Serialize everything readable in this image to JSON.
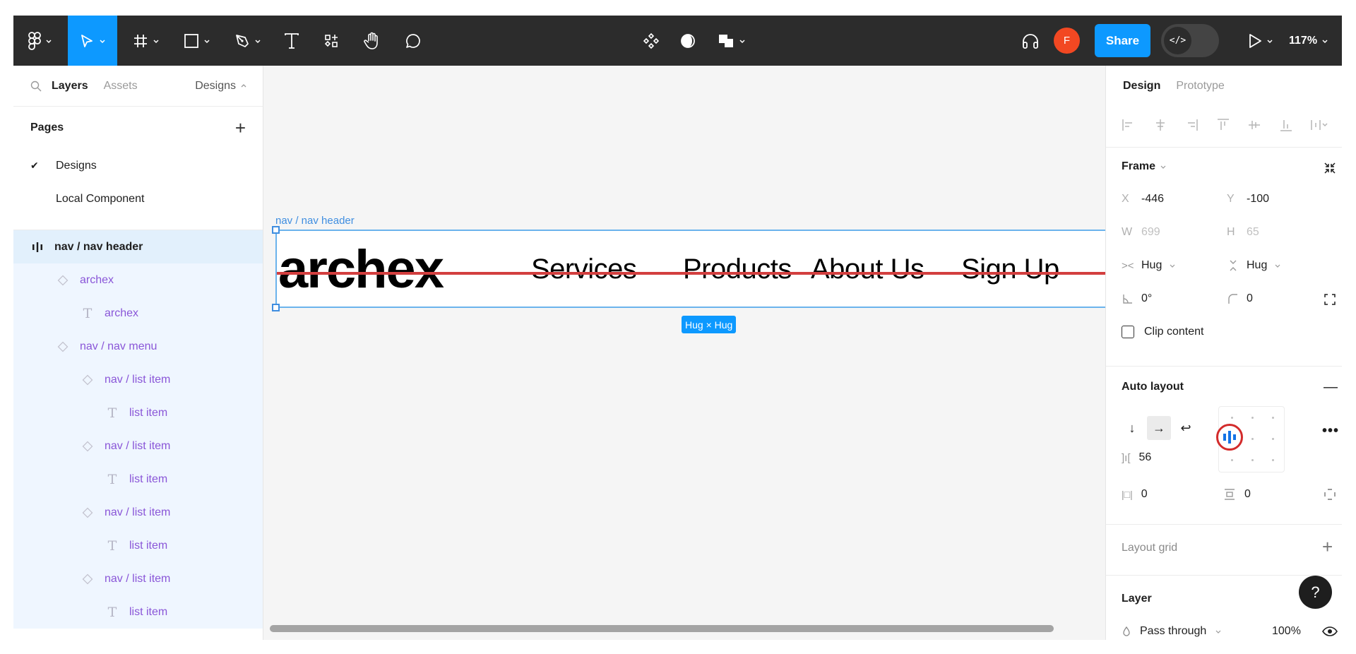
{
  "toolbar": {
    "tools": [
      {
        "name": "main-menu",
        "icon": "figma-logo-icon",
        "has_chevron": true
      },
      {
        "name": "move-tool",
        "icon": "move-cursor-icon",
        "has_chevron": true,
        "active": true
      },
      {
        "name": "frame-tool",
        "icon": "frame-hash-icon",
        "has_chevron": true
      },
      {
        "name": "shape-tool",
        "icon": "rectangle-icon",
        "has_chevron": true
      },
      {
        "name": "pen-tool",
        "icon": "pen-icon",
        "has_chevron": true
      },
      {
        "name": "text-tool",
        "icon": "text-icon",
        "has_chevron": false
      },
      {
        "name": "resources-tool",
        "icon": "resources-icon",
        "has_chevron": false
      },
      {
        "name": "hand-tool",
        "icon": "hand-icon",
        "has_chevron": false
      },
      {
        "name": "comment-tool",
        "icon": "comment-icon",
        "has_chevron": false
      }
    ],
    "center_tools": [
      {
        "name": "component",
        "icon": "component-icon"
      },
      {
        "name": "mask",
        "icon": "mask-icon"
      },
      {
        "name": "boolean",
        "icon": "boolean-union-icon",
        "has_chevron": true
      }
    ],
    "audio_icon": "headphones-icon",
    "avatar_initial": "F",
    "share_label": "Share",
    "dev_mode_label": "</>",
    "present_icon": "play-icon",
    "zoom_level": "117%",
    "accent_color": "#0d99ff",
    "avatar_color": "#f24822"
  },
  "left_panel": {
    "tabs": {
      "layers": "Layers",
      "assets": "Assets"
    },
    "page_switcher": "Designs",
    "pages_title": "Pages",
    "add_page_label": "+",
    "pages": [
      {
        "label": "Designs",
        "checked": true
      },
      {
        "label": "Local Component",
        "checked": false
      }
    ],
    "layers": [
      {
        "label": "nav / nav header",
        "type": "auto-layout-frame",
        "depth": 0,
        "selected": true
      },
      {
        "label": "archex",
        "type": "instance",
        "depth": 1
      },
      {
        "label": "archex",
        "type": "text",
        "depth": 2
      },
      {
        "label": "nav / nav menu",
        "type": "instance",
        "depth": 1
      },
      {
        "label": "nav / list item",
        "type": "instance",
        "depth": 2
      },
      {
        "label": "list item",
        "type": "text",
        "depth": 3
      },
      {
        "label": "nav / list item",
        "type": "instance",
        "depth": 2
      },
      {
        "label": "list item",
        "type": "text",
        "depth": 3
      },
      {
        "label": "nav / list item",
        "type": "instance",
        "depth": 2
      },
      {
        "label": "list item",
        "type": "text",
        "depth": 3
      },
      {
        "label": "nav / list item",
        "type": "instance",
        "depth": 2
      },
      {
        "label": "list item",
        "type": "text",
        "depth": 3
      }
    ]
  },
  "canvas": {
    "frame_label": "nav / nav header",
    "brand": "archex",
    "nav_items": [
      "Services",
      "Products",
      "About Us",
      "Sign Up"
    ],
    "size_badge": "Hug × Hug",
    "selection_color": "#3f8ee0",
    "guide_color": "#d33f3f"
  },
  "right_panel": {
    "tabs": {
      "design": "Design",
      "prototype": "Prototype"
    },
    "frame": {
      "title": "Frame",
      "x_label": "X",
      "x": "-446",
      "y_label": "Y",
      "y": "-100",
      "w_label": "W",
      "w": "699",
      "h_label": "H",
      "h": "65",
      "width_mode": "Hug",
      "height_mode": "Hug",
      "rotation": "0°",
      "corner_radius": "0",
      "clip_content_label": "Clip content",
      "clip_content": false
    },
    "auto_layout": {
      "title": "Auto layout",
      "direction": "horizontal",
      "gap": "56",
      "padding_horizontal": "0",
      "padding_vertical": "0",
      "alignment": "left-center"
    },
    "layout_grid": {
      "title": "Layout grid"
    },
    "layer": {
      "title": "Layer",
      "blend_mode": "Pass through",
      "opacity": "100%"
    },
    "help_label": "?"
  }
}
